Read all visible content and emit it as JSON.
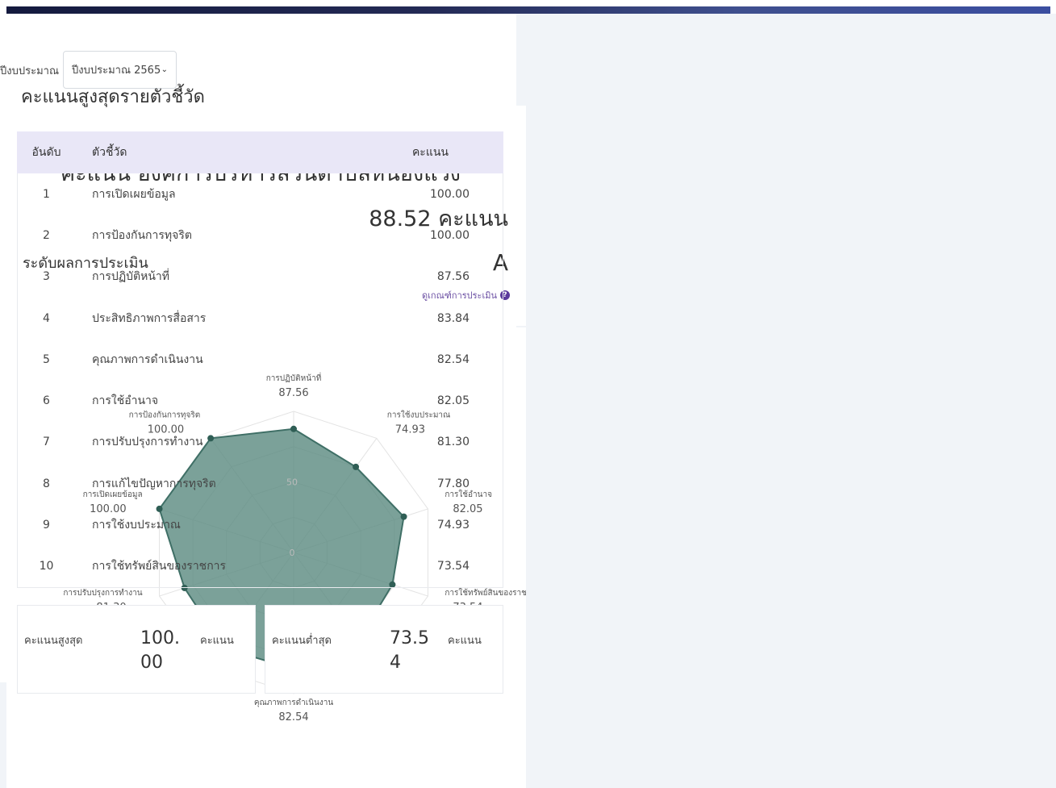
{
  "filter": {
    "label": "ปีงบประมาณ",
    "selected": "ปีงบประมาณ 2565"
  },
  "score_card": {
    "title": "คะแนน องค์การบริหารส่วนตำบลหนองแวง",
    "total": "88.52 คะแนน",
    "level_label": "ระดับผลการประเมิน",
    "grade": "A",
    "criteria_link": "ดูเกณฑ์การประเมิน"
  },
  "chart_data": {
    "type": "radar",
    "axes": [
      {
        "label": "การปฏิบัติหน้าที่",
        "value": 87.56,
        "value_text": "87.56"
      },
      {
        "label": "การใช้งบประมาณ",
        "value": 74.93,
        "value_text": "74.93"
      },
      {
        "label": "การใช้อำนาจ",
        "value": 82.05,
        "value_text": "82.05"
      },
      {
        "label": "การใช้ทรัพย์สินของราชการ",
        "value": 73.54,
        "value_text": "73.54"
      },
      {
        "label": "การแก้ไขปัญหาการทุจริต",
        "value": 77.8,
        "value_text": "77.80"
      },
      {
        "label": "คุณภาพการดำเนินงาน",
        "value": 82.54,
        "value_text": "82.54"
      },
      {
        "label": "ประสิทธิภาพการสื่อสาร",
        "value": 83.84,
        "value_text": "83.84"
      },
      {
        "label": "การปรับปรุงการทำงาน",
        "value": 81.3,
        "value_text": "81.30"
      },
      {
        "label": "การเปิดเผยข้อมูล",
        "value": 100.0,
        "value_text": "100.00"
      },
      {
        "label": "การป้องกันการทุจริต",
        "value": 100.0,
        "value_text": "100.00"
      }
    ],
    "range": [
      0,
      100
    ],
    "ticks": [
      "0",
      "50"
    ],
    "grid": true,
    "colors": {
      "fill": "#5a8a80",
      "stroke": "#3f6f66",
      "point": "#2f5e55",
      "grid": "#e3e3e3"
    }
  },
  "ranking": {
    "title": "คะแนนสูงสุดรายตัวชี้วัด",
    "headers": {
      "rank": "อันดับ",
      "indicator": "ตัวชี้วัด",
      "score": "คะแนน"
    },
    "rows": [
      {
        "rank": "1",
        "name": "การเปิดเผยข้อมูล",
        "score": "100.00"
      },
      {
        "rank": "2",
        "name": "การป้องกันการทุจริต",
        "score": "100.00"
      },
      {
        "rank": "3",
        "name": "การปฏิบัติหน้าที่",
        "score": "87.56"
      },
      {
        "rank": "4",
        "name": "ประสิทธิภาพการสื่อสาร",
        "score": "83.84"
      },
      {
        "rank": "5",
        "name": "คุณภาพการดำเนินงาน",
        "score": "82.54"
      },
      {
        "rank": "6",
        "name": "การใช้อำนาจ",
        "score": "82.05"
      },
      {
        "rank": "7",
        "name": "การปรับปรุงการทำงาน",
        "score": "81.30"
      },
      {
        "rank": "8",
        "name": "การแก้ไขปัญหาการทุจริต",
        "score": "77.80"
      },
      {
        "rank": "9",
        "name": "การใช้งบประมาณ",
        "score": "74.93"
      },
      {
        "rank": "10",
        "name": "การใช้ทรัพย์สินของราชการ",
        "score": "73.54"
      }
    ]
  },
  "summary": {
    "high": {
      "label": "คะแนนสูงสุด",
      "value": "100.00",
      "unit": "คะแนน"
    },
    "low": {
      "label": "คะแนนต่ำสุด",
      "value": "73.54",
      "unit": "คะแนน"
    }
  }
}
